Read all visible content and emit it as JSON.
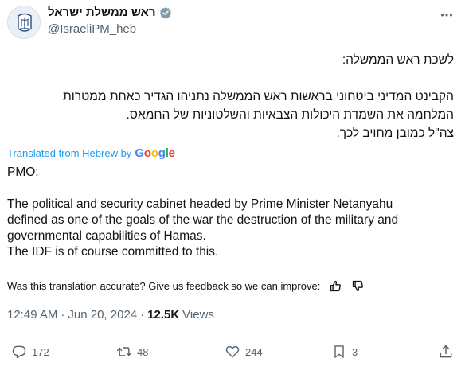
{
  "author": {
    "display_name": "ראש ממשלת ישראל",
    "handle": "@IsraeliPM_heb"
  },
  "post": {
    "hebrew_lines": [
      "לשכת ראש הממשלה:",
      "",
      "הקבינט המדיני ביטחוני בראשות ראש הממשלה נתניהו הגדיר כאחת ממטרות",
      "המלחמה את השמדת היכולות הצבאיות והשלטוניות של החמאס.",
      "צה\"ל כמובן מחויב לכך."
    ],
    "translated_label": "Translated from Hebrew by",
    "translator": "Google",
    "english_lines": [
      "PMO:",
      "",
      "The political and security cabinet headed by Prime Minister Netanyahu",
      "defined as one of the goals of the war the destruction of the military and",
      "governmental capabilities of Hamas.",
      "The IDF is of course committed to this."
    ],
    "feedback_prompt": "Was this translation accurate? Give us feedback so we can improve:",
    "time": "12:49 AM",
    "separator": "·",
    "date": "Jun 20, 2024",
    "views_count": "12.5K",
    "views_label": "Views"
  },
  "actions": {
    "replies": "172",
    "reposts": "48",
    "likes": "244",
    "bookmarks": "3"
  },
  "icons": {
    "avatar": "emblem-of-israel",
    "verified": "gray-verified-badge",
    "more": "more-icon",
    "reply": "reply-icon",
    "repost": "repost-icon",
    "like": "heart-icon",
    "bookmark": "bookmark-icon",
    "share": "share-icon",
    "thumbs_up": "thumbs-up-icon",
    "thumbs_down": "thumbs-down-icon"
  },
  "colors": {
    "link": "#1d9bf0",
    "secondary_text": "#536471",
    "verified_gray": "#829aab"
  }
}
